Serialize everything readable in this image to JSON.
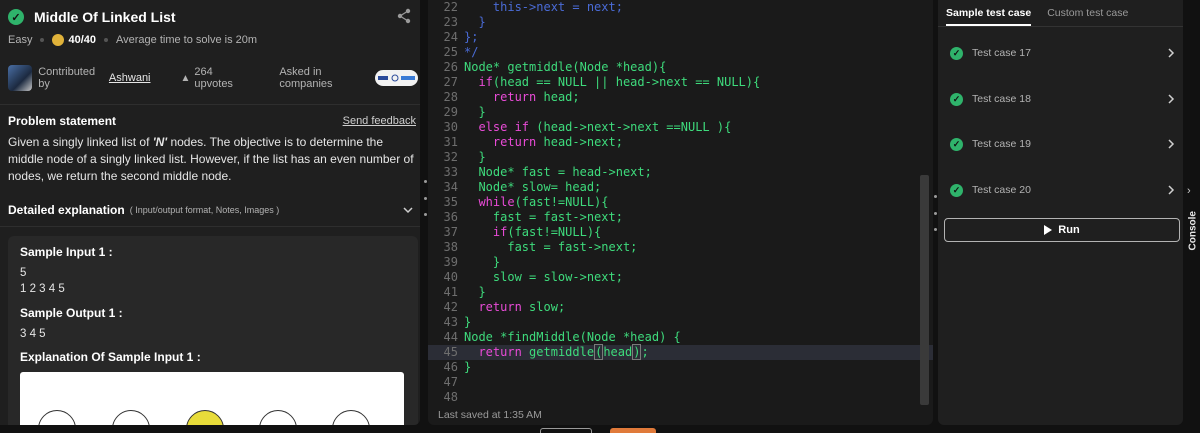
{
  "problem": {
    "title": "Middle Of Linked List",
    "difficulty": "Easy",
    "score": "40/40",
    "avg_time": "Average time to solve is 20m",
    "contributed_by_label": "Contributed by",
    "contributor": "Ashwani",
    "upvotes": "264 upvotes",
    "asked_label": "Asked in companies",
    "statement_title": "Problem statement",
    "feedback_label": "Send feedback",
    "statement_pre": "Given a singly linked list of ",
    "statement_em": "'N'",
    "statement_post": " nodes. The objective is to determine the middle node of a singly linked list. However, if the list has an even number of nodes, we return the second middle node.",
    "detail_title": "Detailed explanation",
    "detail_sub": "( Input/output format, Notes, Images )",
    "sample_input_label": "Sample Input 1 :",
    "sample_input_line1": "5",
    "sample_input_line2": "1 2 3 4 5",
    "sample_output_label": "Sample Output 1 :",
    "sample_output": "3 4 5",
    "explanation_label": "Explanation Of Sample Input 1 :"
  },
  "editor": {
    "saved": "Last saved at 1:35 AM",
    "line_numbers": [
      "22",
      "23",
      "24",
      "25",
      "26",
      "27",
      "28",
      "29",
      "30",
      "31",
      "32",
      "33",
      "34",
      "35",
      "36",
      "37",
      "38",
      "39",
      "40",
      "41",
      "42",
      "43",
      "44",
      "45",
      "46",
      "47",
      "48"
    ]
  },
  "tests": {
    "tab_sample": "Sample test case",
    "tab_custom": "Custom test case",
    "cases": [
      "Test case 17",
      "Test case 18",
      "Test case 19",
      "Test case 20"
    ],
    "run_label": "Run"
  },
  "console": {
    "label": "Console"
  },
  "colors": {
    "success": "#2fb36b",
    "keyword": "#e94bd7",
    "type": "#3edb7c",
    "comment": "#4a6bd6"
  }
}
